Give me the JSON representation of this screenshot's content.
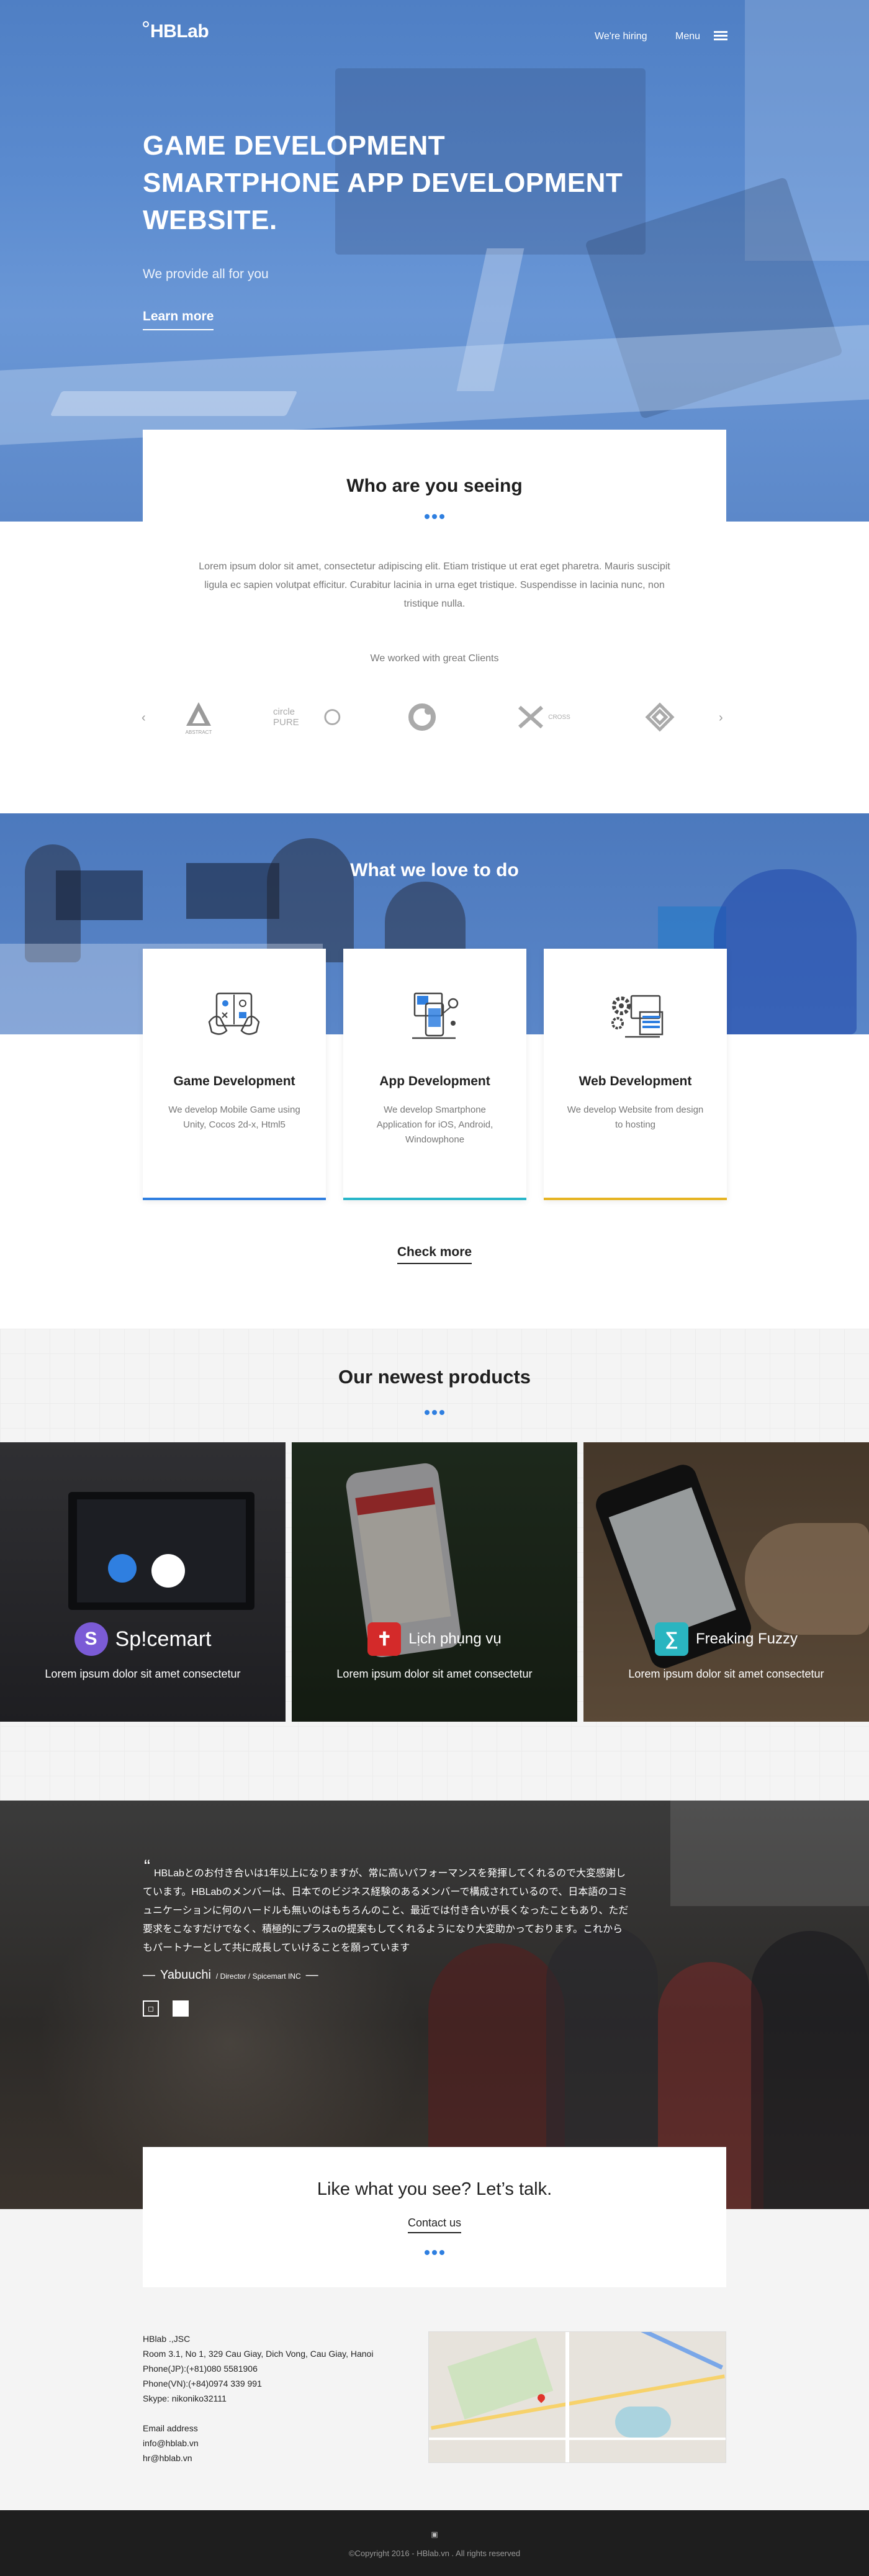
{
  "header": {
    "logo": "HBLab",
    "nav_hiring": "We're hiring",
    "nav_menu": "Menu"
  },
  "hero": {
    "line1": "GAME DEVELOPMENT",
    "line2": "SMARTPHONE APP DEVELOPMENT",
    "line3": "WEBSITE.",
    "subtitle": "We provide all for you",
    "cta": "Learn more"
  },
  "who": {
    "title": "Who are you seeing",
    "description": "Lorem ipsum dolor sit amet, consectetur adipiscing elit. Etiam tristique ut erat eget pharetra. Mauris suscipit ligula ec sapien volutpat efficitur. Curabitur lacinia in urna eget tristique. Suspendisse in lacinia nunc, non tristique nulla.",
    "clients_title": "We worked with great Clients",
    "clients": [
      {
        "name": "ABSTRACT",
        "icon": "triangle-a-icon"
      },
      {
        "name": "circle PURE",
        "icon": "circle-icon"
      },
      {
        "name": "",
        "icon": "ring-logo-icon"
      },
      {
        "name": "CROSS",
        "icon": "cross-icon"
      },
      {
        "name": "",
        "icon": "diamond-icon"
      }
    ]
  },
  "love": {
    "title": "What we love to do",
    "services": [
      {
        "title": "Game Development",
        "desc": "We develop Mobile Game using Unity, Cocos 2d-x, Html5",
        "icon": "gamepad-icon",
        "bar_color": "#2f7fe0"
      },
      {
        "title": "App Development",
        "desc": "We develop Smartphone Application for iOS, Android, Windowphone",
        "icon": "smartphone-icon",
        "bar_color": "#28b6c9"
      },
      {
        "title": "Web Development",
        "desc": "We develop Website from design to hosting",
        "icon": "browser-gear-icon",
        "bar_color": "#e6b423"
      }
    ],
    "check_more": "Check more"
  },
  "products": {
    "title": "Our newest products",
    "items": [
      {
        "name": "Sp!cemart",
        "desc": "Lorem ipsum dolor sit amet consectetur",
        "badge_color": "#7b5bd6",
        "badge_glyph": "S"
      },
      {
        "name": "Lịch phụng vụ",
        "desc": "Lorem ipsum dolor sit amet consectetur",
        "badge_color": "#d42a2a",
        "badge_glyph": "✝"
      },
      {
        "name": "Freaking Fuzzy",
        "desc": "Lorem ipsum dolor sit amet consectetur",
        "badge_color": "#2ab5c0",
        "badge_glyph": "∑"
      }
    ]
  },
  "testimonial": {
    "quote": "HBLabとのお付き合いは1年以上になりますが、常に高いパフォーマンスを発揮してくれるので大変感謝しています。HBLabのメンバーは、日本でのビジネス経験のあるメンバーで構成されているので、日本語のコミュニケーションに何のハードルも無いのはもちろんのこと、最近では付き合いが長くなったこともあり、ただ要求をこなすだけでなく、積極的にプラスαの提案もしてくれるようになり大変助かっております。これからもパートナーとして共に成長していけることを願っています",
    "author": "Yabuuchi",
    "role": "/ Director / Spicemart INC"
  },
  "contact": {
    "title": "Like what you see? Let’s talk.",
    "cta": "Contact us"
  },
  "address": {
    "company": "HBlab .,JSC",
    "line": "Room 3.1, No 1, 329 Cau Giay, Dich Vong, Cau Giay, Hanoi",
    "phone_jp": "Phone(JP):(+81)080 5581906",
    "phone_vn": "Phone(VN):(+84)0974 339 991",
    "skype": "Skype: nikoniko32111",
    "email_label": "Email address",
    "email1": "info@hblab.vn",
    "email2": "hr@hblab.vn"
  },
  "footer": {
    "copyright": "©Copyright 2016 - HBlab.vn . All rights reserved"
  }
}
